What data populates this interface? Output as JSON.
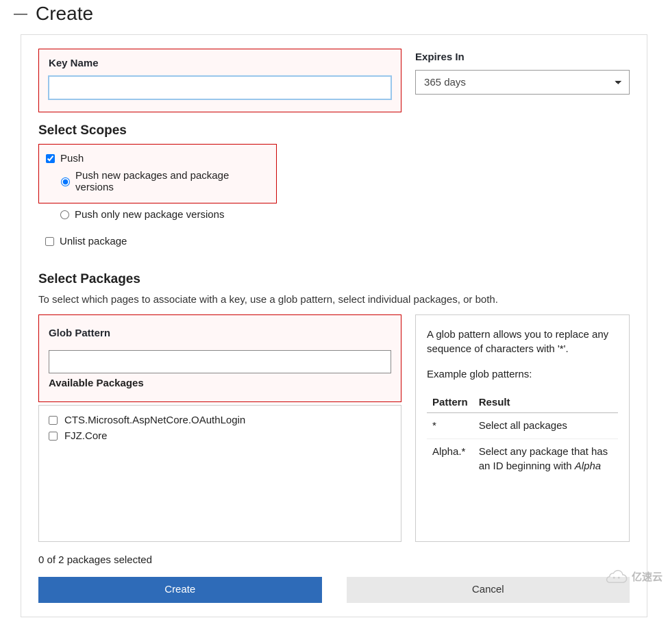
{
  "header": {
    "title": "Create"
  },
  "fields": {
    "key_name": {
      "label": "Key Name",
      "value": ""
    },
    "expires": {
      "label": "Expires In",
      "selected": "365 days"
    },
    "glob": {
      "label": "Glob Pattern",
      "value": ""
    }
  },
  "scopes": {
    "title": "Select Scopes",
    "push_label": "Push",
    "push_new_label": "Push new packages and package versions",
    "push_only_label": "Push only new package versions",
    "unlist_label": "Unlist package"
  },
  "packages": {
    "title": "Select Packages",
    "desc": "To select which pages to associate with a key, use a glob pattern, select individual packages, or both.",
    "available_label": "Available Packages",
    "items": [
      "CTS.Microsoft.AspNetCore.OAuthLogin",
      "FJZ.Core"
    ],
    "selected_count": "0 of 2 packages selected"
  },
  "help": {
    "intro": "A glob pattern allows you to replace any sequence of characters with '*'.",
    "example_label": "Example glob patterns:",
    "table": {
      "col_pattern": "Pattern",
      "col_result": "Result",
      "rows": [
        {
          "pattern": "*",
          "result": "Select all packages"
        },
        {
          "pattern": "Alpha.*",
          "result_prefix": "Select any package that has an ID beginning with ",
          "result_em": "Alpha"
        }
      ]
    }
  },
  "buttons": {
    "create": "Create",
    "cancel": "Cancel"
  },
  "watermark": "亿速云"
}
